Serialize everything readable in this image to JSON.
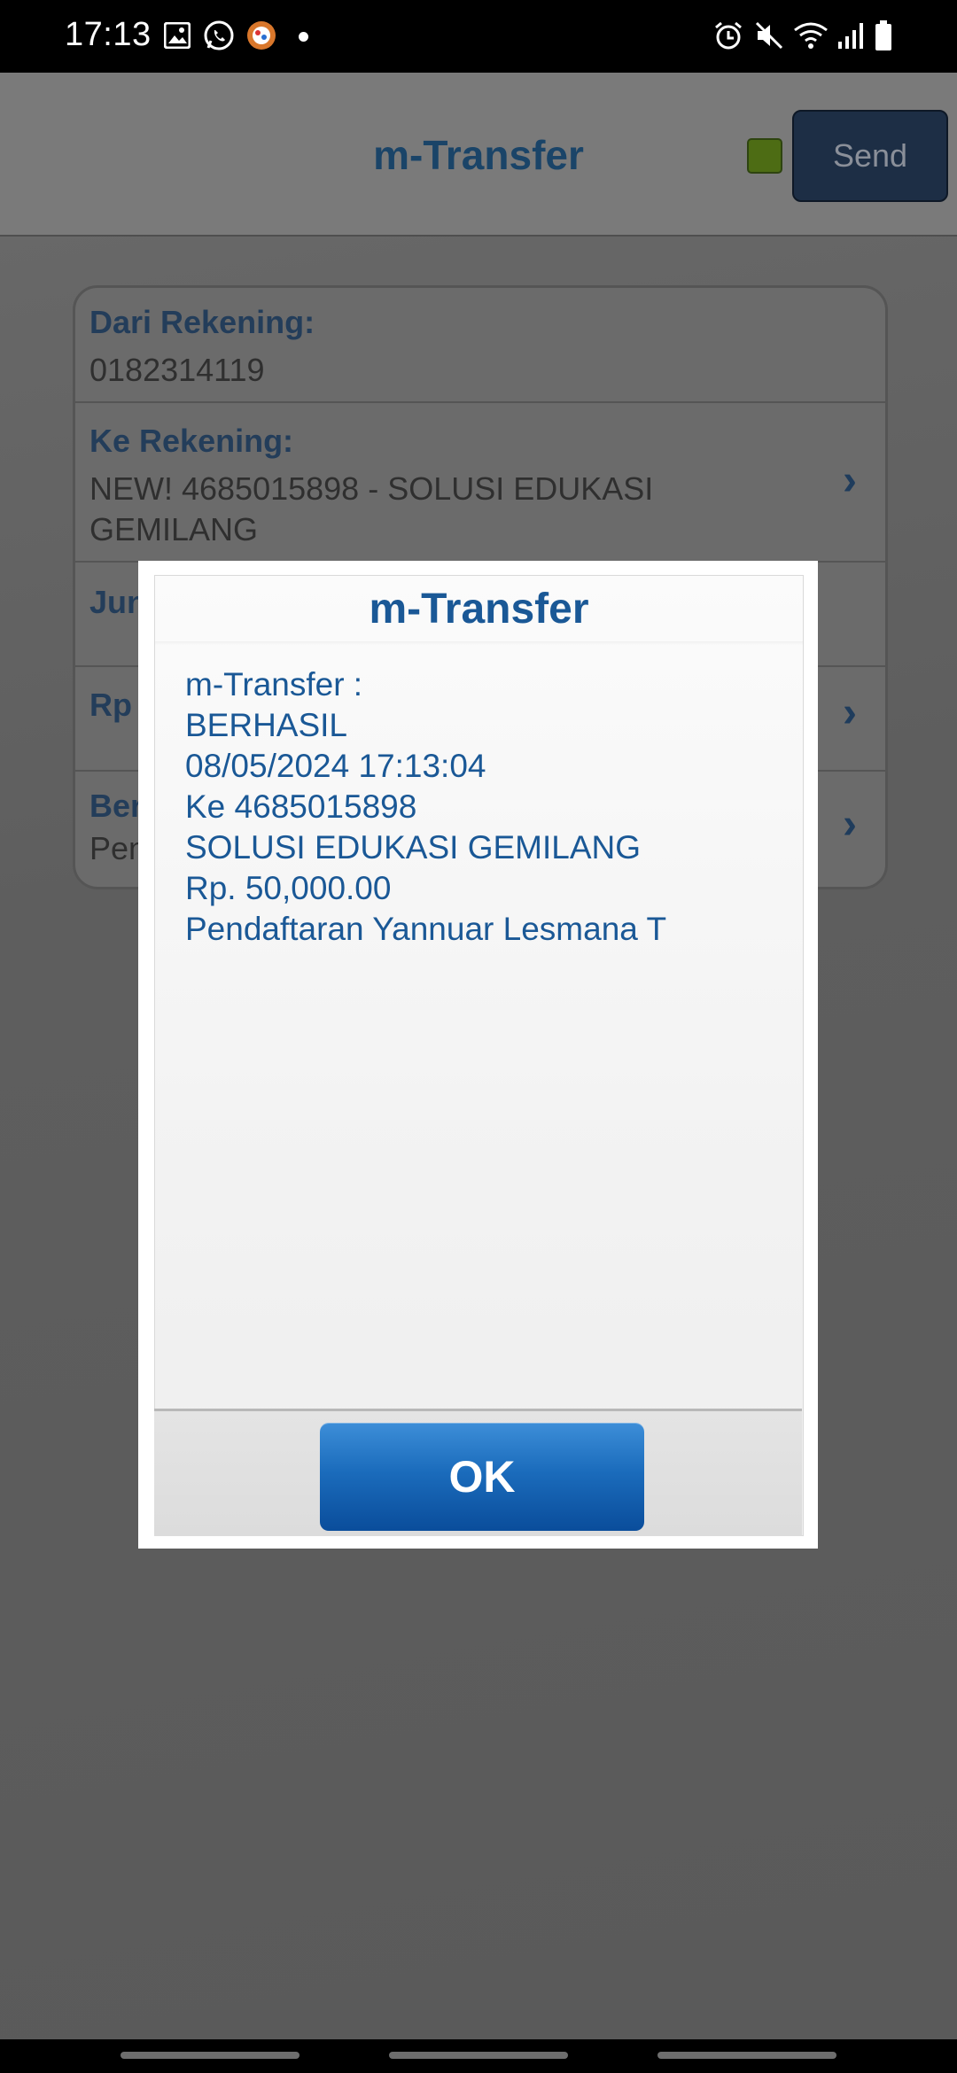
{
  "status_bar": {
    "time": "17:13",
    "left_icons": [
      "image-icon",
      "whatsapp-icon",
      "app-badge-icon"
    ],
    "right_icons": [
      "alarm-icon",
      "mute-icon",
      "wifi-icon",
      "signal-icon",
      "battery-icon"
    ]
  },
  "header": {
    "title": "m-Transfer",
    "send_label": "Send",
    "indicator_color": "#4d6c14"
  },
  "form": {
    "rows": [
      {
        "label": "Dari Rekening:",
        "value": "0182314119"
      },
      {
        "label": "Ke Rekening:",
        "value": "NEW! 4685015898 - SOLUSI EDUKASI GEMILANG"
      },
      {
        "label": "Jun",
        "value": ""
      },
      {
        "label": "Rp",
        "value": ""
      },
      {
        "label": "Ber",
        "value": "Pen"
      }
    ]
  },
  "dialog": {
    "title": "m-Transfer",
    "lines": [
      "m-Transfer :",
      "BERHASIL",
      "08/05/2024 17:13:04",
      "Ke 4685015898",
      "SOLUSI EDUKASI GEMILANG",
      "Rp. 50,000.00",
      "Pendaftaran Yannuar Lesmana T"
    ],
    "ok_label": "OK",
    "accent_color": "#1a5896"
  }
}
